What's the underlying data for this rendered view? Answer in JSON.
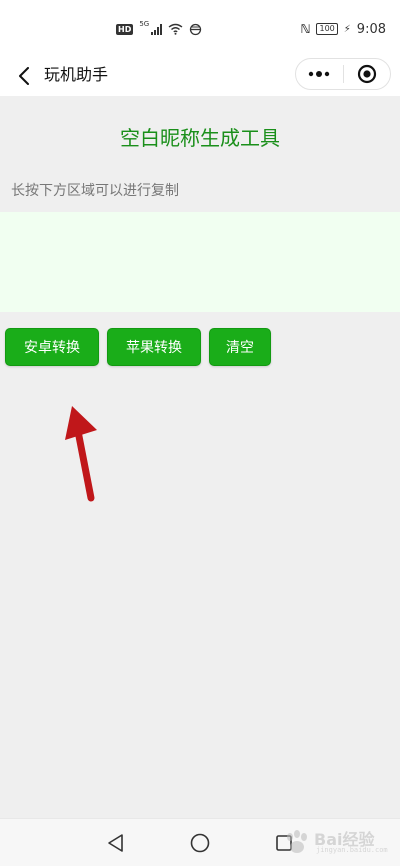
{
  "status_bar": {
    "hd": "HD",
    "network": "5G",
    "battery": "100",
    "time": "9:08"
  },
  "header": {
    "title": "玩机助手"
  },
  "main": {
    "title": "空白昵称生成工具",
    "hint": "长按下方区域可以进行复制",
    "textarea_value": "",
    "buttons": {
      "android": "安卓转换",
      "apple": "苹果转换",
      "clear": "清空"
    }
  },
  "watermark": {
    "text": "Bai经验",
    "sub": "jingyan.baidu.com"
  },
  "colors": {
    "accent": "#1aad19",
    "title_green": "#1a8f1a",
    "textarea_bg": "#f1fff1",
    "annotation_arrow": "#c0171a"
  }
}
